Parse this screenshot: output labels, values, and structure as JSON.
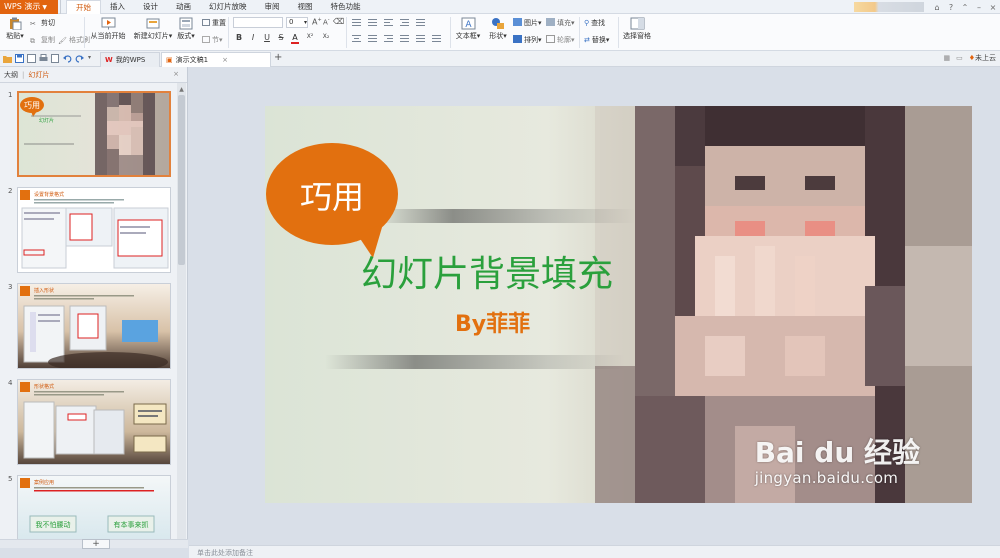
{
  "app": {
    "name": "WPS 演示"
  },
  "menu": {
    "tabs": [
      "开始",
      "插入",
      "设计",
      "动画",
      "幻灯片放映",
      "审阅",
      "视图",
      "特色功能"
    ],
    "active": 0
  },
  "ribbon": {
    "paste": "粘贴",
    "cut": "剪切",
    "copy": "复制",
    "format_painter": "格式刷",
    "play_from_current": "从当前开始",
    "new_slide": "新建幻灯片",
    "layout": "版式",
    "reset": "重置",
    "section": "节",
    "font_size_value": "0",
    "textbox": "文本框",
    "shape": "形状",
    "picture": "图片",
    "arrange": "排列",
    "fill": "填充",
    "outline": "轮廓",
    "find": "查找",
    "replace": "替换",
    "select_pane": "选择窗格",
    "fmt_buttons": [
      "B",
      "I",
      "U",
      "S",
      "A",
      "X²",
      "X₂"
    ]
  },
  "doc_tabs": [
    {
      "label": "我的WPS"
    },
    {
      "label": "演示文稿1"
    }
  ],
  "docbar_right": "未上云",
  "left_panel": {
    "tab_outline": "大纲",
    "tab_slides": "幻灯片"
  },
  "slides": [
    {
      "num": "1",
      "bubble": "巧用",
      "subtitle": "幻灯片"
    },
    {
      "num": "2",
      "title": "设置背景格式"
    },
    {
      "num": "3",
      "title": "插入形状"
    },
    {
      "num": "4",
      "title": "形状格式"
    },
    {
      "num": "5",
      "title": "案例应用",
      "btn1": "我不怕腰动",
      "btn2": "有本事来抓"
    }
  ],
  "slide": {
    "bubble_text": "巧用",
    "title": "幻灯片背景填充",
    "byline": "By菲菲"
  },
  "notes_placeholder": "单击此处添加备注",
  "watermark": {
    "logo": "Bai du 经验",
    "url": "jingyan.baidu.com"
  },
  "colors": {
    "accent": "#e2640f",
    "title_green": "#2aa03c",
    "bubble": "#e2700f"
  }
}
